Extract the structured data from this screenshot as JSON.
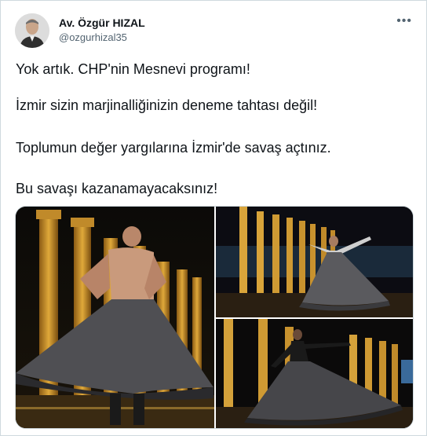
{
  "author": {
    "name": "Av. Özgür HIZAL",
    "handle": "@ozgurhizal35"
  },
  "tweet": {
    "lines": [
      "Yok artık. CHP'nin Mesnevi programı!",
      "İzmir sizin marjinalliğinizin deneme tahtası değil!",
      "Toplumun değer yargılarına İzmir'de savaş açtınız.",
      "Bu savaşı kazanamayacaksınız!"
    ]
  },
  "media": {
    "photos": [
      {
        "scene": "shirtless whirling dancer in front of illuminated ancient columns"
      },
      {
        "scene": "whirling dervish with spread arms on a night stage before lit columns"
      },
      {
        "scene": "whirling dancer in dark clothing in front of lit columns at night"
      }
    ]
  },
  "icons": {
    "more": "more-horizontal-icon"
  },
  "colors": {
    "text": "#0f1419",
    "secondary": "#536471",
    "border": "#cfd9de",
    "column_gold": "#c9962b"
  }
}
